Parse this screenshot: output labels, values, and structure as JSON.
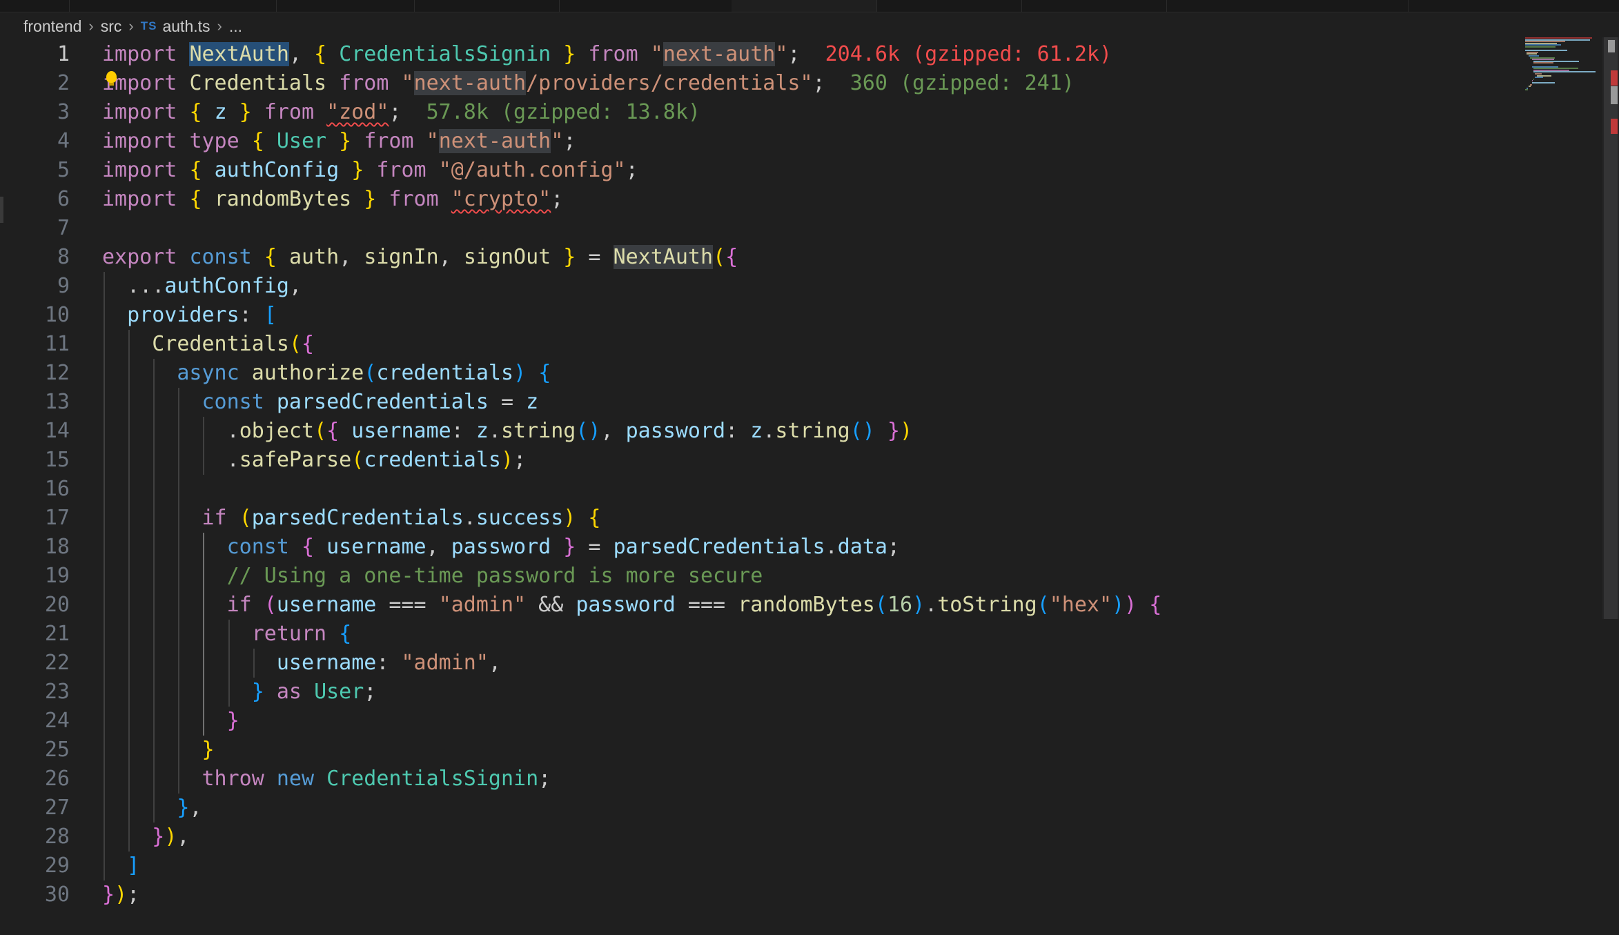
{
  "breadcrumb": {
    "items": [
      "frontend",
      "src"
    ],
    "file_badge": "TS",
    "file_name": "auth.ts",
    "more": "..."
  },
  "editor": {
    "current_line": 1,
    "line_numbers": [
      "1",
      "2",
      "3",
      "4",
      "5",
      "6",
      "7",
      "8",
      "9",
      "10",
      "11",
      "12",
      "13",
      "14",
      "15",
      "16",
      "17",
      "18",
      "19",
      "20",
      "21",
      "22",
      "23",
      "24",
      "25",
      "26",
      "27",
      "28",
      "29",
      "30"
    ],
    "lines": [
      [
        [
          "kwc",
          "import "
        ],
        [
          "fn hl-sym",
          "NextAuth"
        ],
        [
          "",
          "",
          ""
        ],
        [
          "",
          ", "
        ],
        [
          "b1",
          "{ "
        ],
        [
          "ty",
          "CredentialsSignin"
        ],
        [
          "b1",
          " }"
        ],
        [
          "kwc",
          " from "
        ],
        [
          "str",
          "\""
        ],
        [
          "str hl",
          "next-auth"
        ],
        [
          "str",
          "\""
        ],
        [
          "",
          ";  "
        ],
        [
          "hint-red",
          "204.6k (gzipped: 61.2k)"
        ]
      ],
      [
        [
          "kwc",
          "import "
        ],
        [
          "fn",
          "Credentials"
        ],
        [
          "kwc",
          " from "
        ],
        [
          "str",
          "\""
        ],
        [
          "str hl",
          "next-auth"
        ],
        [
          "str",
          "/providers/credentials\""
        ],
        [
          "",
          ";  "
        ],
        [
          "hint-green",
          "360 (gzipped: 241)"
        ]
      ],
      [
        [
          "kwc",
          "import "
        ],
        [
          "b1",
          "{ "
        ],
        [
          "id",
          "z"
        ],
        [
          "b1",
          " }"
        ],
        [
          "kwc",
          " from "
        ],
        [
          "str sq",
          "\"zod\""
        ],
        [
          "",
          ";  "
        ],
        [
          "hint-green",
          "57.8k (gzipped: 13.8k)"
        ]
      ],
      [
        [
          "kwc",
          "import "
        ],
        [
          "kwc",
          "type "
        ],
        [
          "b1",
          "{ "
        ],
        [
          "ty",
          "User"
        ],
        [
          "b1",
          " }"
        ],
        [
          "kwc",
          " from "
        ],
        [
          "str",
          "\""
        ],
        [
          "str hl",
          "next-auth"
        ],
        [
          "str",
          "\""
        ],
        [
          "",
          ";"
        ]
      ],
      [
        [
          "kwc",
          "import "
        ],
        [
          "b1",
          "{ "
        ],
        [
          "id",
          "authConfig"
        ],
        [
          "b1",
          " }"
        ],
        [
          "kwc",
          " from "
        ],
        [
          "str",
          "\"@/auth.config\""
        ],
        [
          "",
          ";"
        ]
      ],
      [
        [
          "kwc",
          "import "
        ],
        [
          "b1",
          "{ "
        ],
        [
          "fn",
          "randomBytes"
        ],
        [
          "b1",
          " }"
        ],
        [
          "kwc",
          " from "
        ],
        [
          "str sq",
          "\"crypto\""
        ],
        [
          "",
          ";"
        ]
      ],
      [],
      [
        [
          "kwc",
          "export "
        ],
        [
          "kw",
          "const "
        ],
        [
          "b1",
          "{ "
        ],
        [
          "fn",
          "auth"
        ],
        [
          "",
          ", "
        ],
        [
          "fn",
          "signIn"
        ],
        [
          "",
          ", "
        ],
        [
          "fn",
          "signOut"
        ],
        [
          "b1",
          " }"
        ],
        [
          "",
          " = "
        ],
        [
          "fn hl",
          "NextAuth"
        ],
        [
          "b1",
          "("
        ],
        [
          "b2",
          "{"
        ]
      ],
      [
        [
          "",
          "  ..."
        ],
        [
          "id",
          "authConfig"
        ],
        [
          "",
          ","
        ]
      ],
      [
        [
          "",
          "  "
        ],
        [
          "id",
          "providers"
        ],
        [
          "",
          ": "
        ],
        [
          "b3",
          "["
        ]
      ],
      [
        [
          "",
          "    "
        ],
        [
          "fn",
          "Credentials"
        ],
        [
          "b1",
          "("
        ],
        [
          "b2",
          "{"
        ]
      ],
      [
        [
          "",
          "      "
        ],
        [
          "kw",
          "async "
        ],
        [
          "fn",
          "authorize"
        ],
        [
          "b3",
          "("
        ],
        [
          "id",
          "credentials"
        ],
        [
          "b3",
          ")"
        ],
        [
          "",
          " "
        ],
        [
          "b3",
          "{"
        ]
      ],
      [
        [
          "",
          "        "
        ],
        [
          "kw",
          "const "
        ],
        [
          "id",
          "parsedCredentials"
        ],
        [
          "",
          " = "
        ],
        [
          "id",
          "z"
        ]
      ],
      [
        [
          "",
          "          ."
        ],
        [
          "fn",
          "object"
        ],
        [
          "b1",
          "("
        ],
        [
          "b2",
          "{ "
        ],
        [
          "id",
          "username"
        ],
        [
          "",
          ": "
        ],
        [
          "id",
          "z"
        ],
        [
          "",
          "."
        ],
        [
          "fn",
          "string"
        ],
        [
          "b3",
          "()"
        ],
        [
          "",
          ", "
        ],
        [
          "id",
          "password"
        ],
        [
          "",
          ": "
        ],
        [
          "id",
          "z"
        ],
        [
          "",
          "."
        ],
        [
          "fn",
          "string"
        ],
        [
          "b3",
          "()"
        ],
        [
          "b2",
          " }"
        ],
        [
          "b1",
          ")"
        ]
      ],
      [
        [
          "",
          "          ."
        ],
        [
          "fn",
          "safeParse"
        ],
        [
          "b1",
          "("
        ],
        [
          "id",
          "credentials"
        ],
        [
          "b1",
          ")"
        ],
        [
          "",
          ";"
        ]
      ],
      [],
      [
        [
          "",
          "        "
        ],
        [
          "kwc",
          "if "
        ],
        [
          "b1",
          "("
        ],
        [
          "id",
          "parsedCredentials"
        ],
        [
          "",
          "."
        ],
        [
          "id",
          "success"
        ],
        [
          "b1",
          ")"
        ],
        [
          "",
          " "
        ],
        [
          "b1",
          "{"
        ]
      ],
      [
        [
          "",
          "          "
        ],
        [
          "kw",
          "const "
        ],
        [
          "b2",
          "{ "
        ],
        [
          "id",
          "username"
        ],
        [
          "",
          ", "
        ],
        [
          "id",
          "password"
        ],
        [
          "b2",
          " }"
        ],
        [
          "",
          " = "
        ],
        [
          "id",
          "parsedCredentials"
        ],
        [
          "",
          "."
        ],
        [
          "id",
          "data"
        ],
        [
          "",
          ";"
        ]
      ],
      [
        [
          "",
          "          "
        ],
        [
          "cm",
          "// Using a one-time password is more secure"
        ]
      ],
      [
        [
          "",
          "          "
        ],
        [
          "kwc",
          "if "
        ],
        [
          "b2",
          "("
        ],
        [
          "id",
          "username"
        ],
        [
          "",
          " === "
        ],
        [
          "str",
          "\"admin\""
        ],
        [
          "",
          " && "
        ],
        [
          "id",
          "password"
        ],
        [
          "",
          " === "
        ],
        [
          "fn",
          "randomBytes"
        ],
        [
          "b3",
          "("
        ],
        [
          "num",
          "16"
        ],
        [
          "b3",
          ")"
        ],
        [
          "",
          "."
        ],
        [
          "fn",
          "toString"
        ],
        [
          "b3",
          "("
        ],
        [
          "str",
          "\"hex\""
        ],
        [
          "b3",
          ")"
        ],
        [
          "b2",
          ")"
        ],
        [
          "",
          " "
        ],
        [
          "b2",
          "{"
        ]
      ],
      [
        [
          "",
          "            "
        ],
        [
          "kwc",
          "return "
        ],
        [
          "b3",
          "{"
        ]
      ],
      [
        [
          "",
          "              "
        ],
        [
          "id",
          "username"
        ],
        [
          "",
          ": "
        ],
        [
          "str",
          "\"admin\""
        ],
        [
          "",
          ","
        ]
      ],
      [
        [
          "",
          "            "
        ],
        [
          "b3",
          "}"
        ],
        [
          "kwc",
          " as "
        ],
        [
          "ty",
          "User"
        ],
        [
          "",
          ";"
        ]
      ],
      [
        [
          "",
          "          "
        ],
        [
          "b2",
          "}"
        ]
      ],
      [
        [
          "",
          "        "
        ],
        [
          "b1",
          "}"
        ]
      ],
      [
        [
          "",
          "        "
        ],
        [
          "kwc",
          "throw "
        ],
        [
          "kw",
          "new "
        ],
        [
          "ty",
          "CredentialsSignin"
        ],
        [
          "",
          ";"
        ]
      ],
      [
        [
          "",
          "      "
        ],
        [
          "b3",
          "}"
        ],
        [
          "",
          ","
        ]
      ],
      [
        [
          "",
          "    "
        ],
        [
          "b2",
          "}"
        ],
        [
          "b1",
          ")"
        ],
        [
          "",
          ","
        ]
      ],
      [
        [
          "",
          "  "
        ],
        [
          "b3",
          "]"
        ]
      ],
      [
        [
          "b2",
          "}"
        ],
        [
          "b1",
          ")"
        ],
        [
          "",
          ";"
        ]
      ]
    ]
  },
  "colors": {
    "background": "#1f1f1f",
    "keyword": "#569cd6",
    "control_keyword": "#c586c0",
    "string": "#ce9178",
    "function": "#dcdcaa",
    "variable": "#9cdcfe",
    "type": "#4ec9b0",
    "comment": "#6a9955",
    "error": "#f14c4c"
  }
}
